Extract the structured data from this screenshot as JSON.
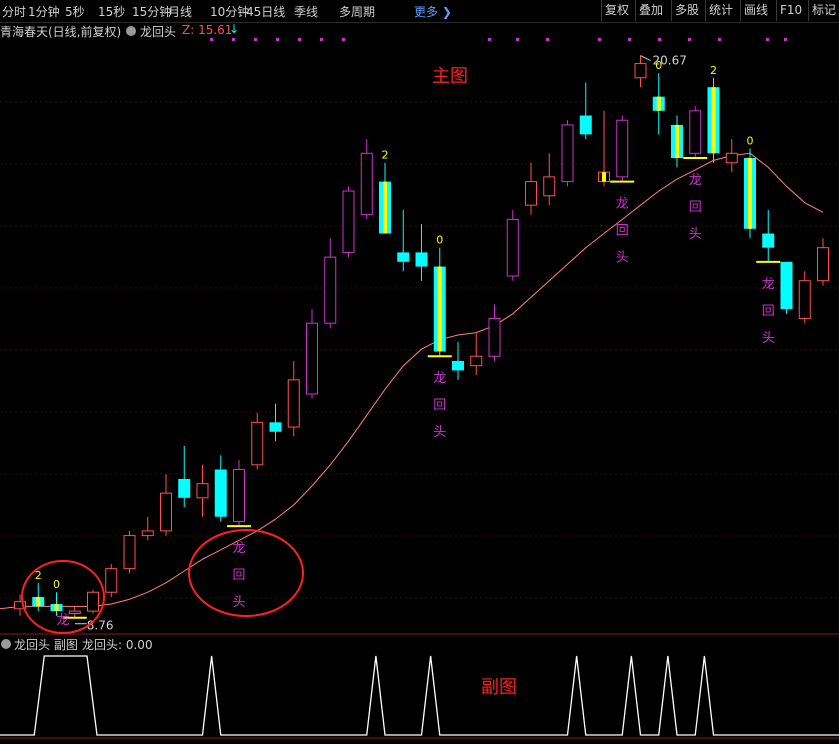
{
  "toolbar": {
    "periods": [
      "分时",
      "1分钟",
      "5秒",
      "15秒",
      "15分钟",
      "月线",
      "10分钟",
      "45日线",
      "季线",
      "多周期"
    ],
    "more": "更多",
    "right_buttons": [
      "复权",
      "叠加",
      "多股",
      "统计",
      "画线",
      "F10",
      "标记"
    ]
  },
  "title": {
    "stock": "青海春天(日线,前复权)",
    "indicator": "龙回头",
    "z_label": "Z: 15.61",
    "arrow": "↓"
  },
  "annotations": {
    "main_label": "主图",
    "sub_label": "副图",
    "dragon": [
      "龙",
      "回",
      "头"
    ],
    "high_price": "20.67",
    "low_price": "8.76"
  },
  "sub_panel": {
    "title": "龙回头 副图",
    "value_label": "龙回头: 0.00"
  },
  "colors": {
    "up": "#ff5050",
    "down": "#00ffff",
    "magenta": "#cc33cc",
    "yellow": "#ffff00",
    "ma": "#ff8080",
    "circle": "#ff2020",
    "label_red": "#ff2020"
  },
  "chart_data": {
    "type": "candlestick",
    "candles": [
      {
        "o": 8.95,
        "c": 9.1,
        "h": 9.25,
        "l": 8.8
      },
      {
        "o": 9.2,
        "c": 9.0,
        "h": 9.5,
        "l": 8.9,
        "s": "y",
        "lab": "2"
      },
      {
        "o": 9.05,
        "c": 8.9,
        "h": 9.3,
        "l": 8.8,
        "s": "y",
        "lab": "0"
      },
      {
        "o": 8.85,
        "c": 8.9,
        "h": 9.0,
        "l": 8.76
      },
      {
        "o": 8.9,
        "c": 9.3,
        "h": 9.35,
        "l": 8.85
      },
      {
        "o": 9.3,
        "c": 9.8,
        "h": 9.9,
        "l": 9.2
      },
      {
        "o": 9.8,
        "c": 10.5,
        "h": 10.6,
        "l": 9.7
      },
      {
        "o": 10.5,
        "c": 10.6,
        "h": 10.9,
        "l": 10.4
      },
      {
        "o": 10.6,
        "c": 11.4,
        "h": 11.8,
        "l": 10.5
      },
      {
        "o": 11.7,
        "c": 11.3,
        "h": 12.4,
        "l": 11.1
      },
      {
        "o": 11.3,
        "c": 11.6,
        "h": 12.0,
        "l": 10.9
      },
      {
        "o": 11.9,
        "c": 10.9,
        "h": 12.2,
        "l": 10.8
      },
      {
        "o": 10.8,
        "c": 11.9,
        "h": 12.1,
        "l": 10.7,
        "s": "m"
      },
      {
        "o": 12.0,
        "c": 12.9,
        "h": 13.1,
        "l": 11.9
      },
      {
        "o": 12.9,
        "c": 12.7,
        "h": 13.3,
        "l": 12.5
      },
      {
        "o": 12.8,
        "c": 13.8,
        "h": 14.2,
        "l": 12.6
      },
      {
        "o": 13.5,
        "c": 15.0,
        "h": 15.3,
        "l": 13.4,
        "s": "m"
      },
      {
        "o": 15.0,
        "c": 16.4,
        "h": 16.8,
        "l": 14.9,
        "s": "m"
      },
      {
        "o": 16.5,
        "c": 17.8,
        "h": 17.9,
        "l": 16.4,
        "s": "m"
      },
      {
        "o": 18.6,
        "c": 17.3,
        "h": 18.9,
        "l": 17.2,
        "s": "m"
      },
      {
        "o": 18.0,
        "c": 16.9,
        "h": 18.4,
        "l": 16.9,
        "s": "y",
        "lab": "2"
      },
      {
        "o": 16.5,
        "c": 16.3,
        "h": 17.4,
        "l": 16.1
      },
      {
        "o": 16.5,
        "c": 16.2,
        "h": 17.1,
        "l": 15.9
      },
      {
        "o": 16.2,
        "c": 14.4,
        "h": 16.6,
        "l": 14.3,
        "s": "y",
        "lab": "0"
      },
      {
        "o": 14.2,
        "c": 14.0,
        "h": 14.6,
        "l": 13.8
      },
      {
        "o": 14.1,
        "c": 14.3,
        "h": 14.8,
        "l": 13.9
      },
      {
        "o": 14.3,
        "c": 15.1,
        "h": 15.4,
        "l": 14.2,
        "s": "m"
      },
      {
        "o": 16.0,
        "c": 17.2,
        "h": 17.4,
        "l": 15.9,
        "s": "m"
      },
      {
        "o": 17.5,
        "c": 18.0,
        "h": 18.4,
        "l": 17.3
      },
      {
        "o": 17.7,
        "c": 18.1,
        "h": 18.6,
        "l": 17.5
      },
      {
        "o": 18.0,
        "c": 19.2,
        "h": 19.3,
        "l": 17.9,
        "s": "m"
      },
      {
        "o": 19.4,
        "c": 19.0,
        "h": 20.1,
        "l": 18.9
      },
      {
        "o": 18.0,
        "c": 18.2,
        "h": 19.5,
        "l": 17.9,
        "s": "y"
      },
      {
        "o": 18.1,
        "c": 19.3,
        "h": 19.4,
        "l": 18.0,
        "s": "m"
      },
      {
        "o": 20.2,
        "c": 20.5,
        "h": 20.67,
        "l": 20.0
      },
      {
        "o": 19.8,
        "c": 19.5,
        "h": 20.3,
        "l": 19.0,
        "s": "y",
        "lab": "0"
      },
      {
        "o": 19.2,
        "c": 18.5,
        "h": 19.4,
        "l": 18.3,
        "s": "y"
      },
      {
        "o": 18.6,
        "c": 19.5,
        "h": 19.6,
        "l": 18.5,
        "s": "m"
      },
      {
        "o": 20.0,
        "c": 18.6,
        "h": 20.2,
        "l": 18.4,
        "s": "y",
        "lab": "2"
      },
      {
        "o": 18.4,
        "c": 18.6,
        "h": 18.9,
        "l": 18.2
      },
      {
        "o": 18.5,
        "c": 17.0,
        "h": 18.7,
        "l": 16.8,
        "s": "y",
        "lab": "0"
      },
      {
        "o": 16.9,
        "c": 16.6,
        "h": 17.4,
        "l": 16.3
      },
      {
        "o": 16.3,
        "c": 15.3,
        "h": 16.3,
        "l": 15.2
      },
      {
        "o": 15.1,
        "c": 15.9,
        "h": 16.1,
        "l": 15.0
      },
      {
        "o": 15.9,
        "c": 16.6,
        "h": 16.8,
        "l": 15.8
      }
    ],
    "ma": [
      9.0,
      9.0,
      9.0,
      9.0,
      9.0,
      9.05,
      9.15,
      9.3,
      9.5,
      9.75,
      10.0,
      10.2,
      10.4,
      10.6,
      10.85,
      11.15,
      11.55,
      12.0,
      12.5,
      13.05,
      13.6,
      14.1,
      14.45,
      14.65,
      14.75,
      14.8,
      14.95,
      15.2,
      15.55,
      15.9,
      16.25,
      16.6,
      16.9,
      17.2,
      17.5,
      17.8,
      18.05,
      18.25,
      18.45,
      18.55,
      18.6,
      18.3,
      17.9,
      17.55,
      17.35
    ],
    "dragon_markers": [
      3,
      12,
      23,
      33,
      37,
      41
    ],
    "sub_signal": [
      [
        1,
        4
      ],
      [
        10,
        11
      ],
      [
        19,
        20
      ],
      [
        22,
        23
      ],
      [
        30,
        31
      ],
      [
        33,
        34
      ],
      [
        35,
        36
      ],
      [
        37,
        38
      ]
    ],
    "ylim": [
      8.5,
      21.0
    ]
  }
}
